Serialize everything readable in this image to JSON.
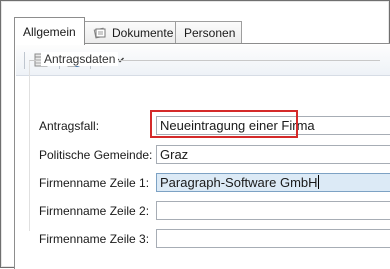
{
  "tabs": [
    {
      "label": "Allgemein",
      "icon": "none"
    },
    {
      "label": "Dokumente",
      "icon": "documents-icon"
    },
    {
      "label": "Personen",
      "icon": "none"
    }
  ],
  "toolbar": {
    "buttons": [
      "table-icon",
      "preview-icon",
      "search-icon",
      "chevron-down-icon"
    ]
  },
  "section": {
    "title": "Antragsdaten"
  },
  "form": {
    "antragsfall": {
      "label": "Antragsfall:",
      "value": "Neueintragung einer Firma"
    },
    "gemeinde": {
      "label": "Politische Gemeinde:",
      "value": "Graz"
    },
    "firmenname1": {
      "label": "Firmenname Zeile 1:",
      "value": "Paragraph-Software GmbH"
    },
    "firmenname2": {
      "label": "Firmenname Zeile 2:",
      "value": ""
    },
    "firmenname3": {
      "label": "Firmenname Zeile 3:",
      "value": ""
    }
  },
  "colors": {
    "highlight": "#d42a2a",
    "focused_field": "#dceaf6"
  }
}
